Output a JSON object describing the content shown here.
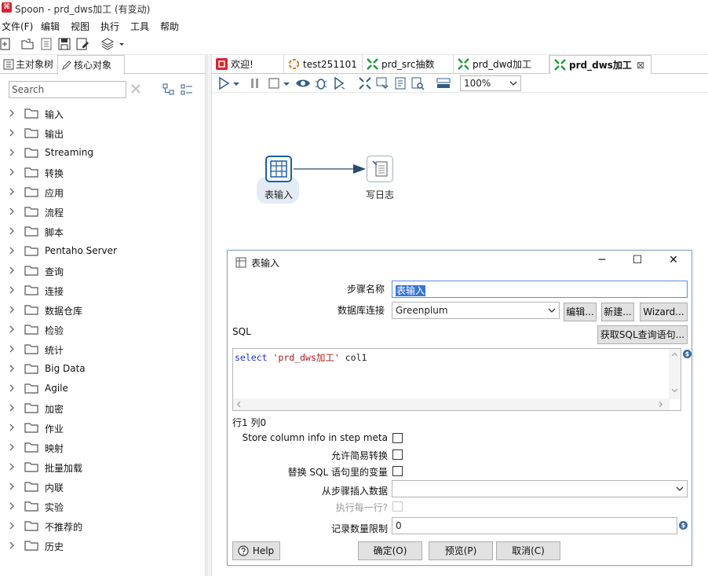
{
  "window": {
    "title": "Spoon - prd_dws加工 (有变动)",
    "app_icon_glyph": "⌘"
  },
  "menu": [
    "文件(F)",
    "编辑",
    "视图",
    "执行",
    "工具",
    "帮助"
  ],
  "left_panel": {
    "tabs": [
      "主对象树",
      "核心对象"
    ],
    "search_placeholder": "Search",
    "categories": [
      "输入",
      "输出",
      "Streaming",
      "转换",
      "应用",
      "流程",
      "脚本",
      "Pentaho Server",
      "查询",
      "连接",
      "数据仓库",
      "检验",
      "统计",
      "Big Data",
      "Agile",
      "加密",
      "作业",
      "映射",
      "批量加载",
      "内联",
      "实验",
      "不推荐的",
      "历史"
    ]
  },
  "editor_tabs": [
    {
      "label": "欢迎!",
      "icon": "spoon-icon"
    },
    {
      "label": "test251101",
      "icon": "job-icon"
    },
    {
      "label": "prd_src抽数",
      "icon": "transformation-icon"
    },
    {
      "label": "prd_dwd加工",
      "icon": "transformation-icon"
    },
    {
      "label": "prd_dws加工",
      "icon": "transformation-icon",
      "active": true,
      "close": "⊠"
    }
  ],
  "zoom": "100%",
  "canvas": {
    "steps": [
      {
        "name": "表输入",
        "icon": "table-input-icon",
        "selected": true
      },
      {
        "name": "写日志",
        "icon": "write-log-icon"
      }
    ]
  },
  "dialog": {
    "title": "表输入",
    "step_name_label": "步骤名称",
    "step_name_value": "表输入",
    "db_connection_label": "数据库连接",
    "db_connection_value": "Greenplum",
    "edit_button": "编辑...",
    "new_button": "新建...",
    "wizard_button": "Wizard...",
    "sql_label": "SQL",
    "get_sql_button": "获取SQL查询语句...",
    "sql": {
      "keyword": "select",
      "string": "'prd_dws加工'",
      "rest": " col1"
    },
    "cursor_pos": "行1 列0",
    "store_column_info_label": "Store column info in step meta",
    "allow_lazy_conversion_label": "允许简易转换",
    "replace_variables_label": "替换 SQL 语句里的变量",
    "insert_from_step_label": "从步骤插入数据",
    "insert_from_step_value": "",
    "execute_each_row_label": "执行每一行?",
    "limit_label": "记录数量限制",
    "limit_value": "0",
    "help_button": "Help",
    "ok_button": "确定(O)",
    "preview_button": "预览(P)",
    "cancel_button": "取消(C)",
    "variable_glyph": "$"
  },
  "colors": {
    "accent": "#1a5faa",
    "selection": "#3875d7",
    "transformation_green": "#1f9b3a",
    "step_selected_bg": "#e3ebf4"
  }
}
